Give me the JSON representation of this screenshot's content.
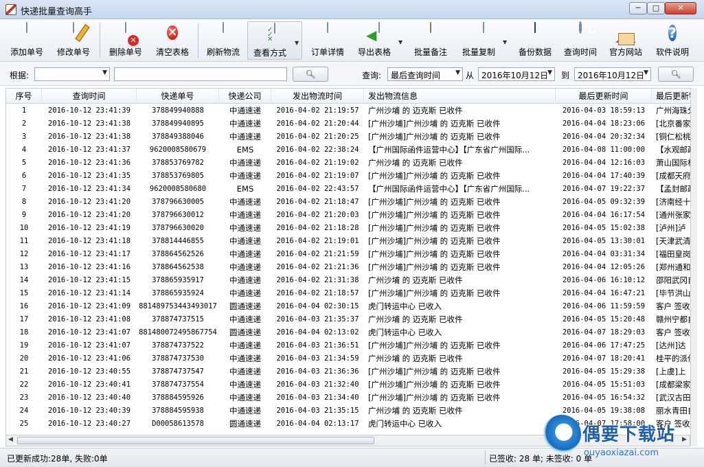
{
  "window": {
    "title": "快递批量查询高手",
    "controls": {
      "minimize": "─",
      "maximize": "□",
      "close": "✕"
    }
  },
  "toolbar": {
    "add": "添加单号",
    "edit": "修改单号",
    "delete": "删除单号",
    "clear": "清空表格",
    "refresh": "刷新物流",
    "view": "查看方式",
    "detail": "订单详情",
    "export": "导出表格",
    "batch_note": "批量备注",
    "batch_copy": "批量复制",
    "backup": "备份数据",
    "query_time": "查询时间",
    "website": "官方网站",
    "help": "软件说明"
  },
  "search": {
    "by_label": "根据:",
    "by_value": "",
    "keyword": "",
    "query_label": "查询:",
    "query_mode": "最后查询时间",
    "from_label": "从",
    "from_date": "2016年10月12日",
    "to_label": "到",
    "to_date": "2016年10月12日"
  },
  "table": {
    "columns": [
      "序号",
      "查询时间",
      "快递单号",
      "快递公司",
      "发出物流时间",
      "发出物流信息",
      "最后更新时间",
      "最后更新物"
    ],
    "rows": [
      [
        "1",
        "2016-10-12 23:41:39",
        "378849940888",
        "中通速递",
        "2016-04-02 21:19:57",
        "广州沙埔 的 迈克斯 已收件",
        "2016-04-03 18:59:13",
        "广州海珠分"
      ],
      [
        "2",
        "2016-10-12 23:41:38",
        "378849940895",
        "中通速递",
        "2016-04-02 21:20:44",
        "[广州沙埔]广州沙埔 的 迈克斯 已收件",
        "2016-04-04 18:23:06",
        "[北京番家"
      ],
      [
        "3",
        "2016-10-12 23:41:38",
        "378849388046",
        "中通速递",
        "2016-04-02 21:20:25",
        "[广州沙埔]广州沙埔 的 迈克斯 已收件",
        "2016-04-04 20:32:34",
        "[铜仁松桃"
      ],
      [
        "4",
        "2016-10-12 23:41:37",
        "9620008580679",
        "EMS",
        "2016-04-02 22:38:24",
        "【广州国际函件运营中心】【广东省广州国际...",
        "2016-04-08 11:00:00",
        "【水观邮政"
      ],
      [
        "5",
        "2016-10-12 23:41:36",
        "378853769782",
        "中通速递",
        "2016-04-02 21:19:02",
        "广州沙埔 的 迈克斯 已收件",
        "2016-04-04 12:16:03",
        "萧山国际机"
      ],
      [
        "6",
        "2016-10-12 23:41:35",
        "378853769805",
        "中通速递",
        "2016-04-02 21:19:07",
        "[广州沙埔]广州沙埔 的 迈克斯 已收件",
        "2016-04-04 17:40:39",
        "[成都天府"
      ],
      [
        "7",
        "2016-10-12 23:41:34",
        "9620008580680",
        "EMS",
        "2016-04-02 22:43:57",
        "【广州国际函件运营中心】【广东省广州国际...",
        "2016-04-07 19:22:37",
        "【孟封邮政"
      ],
      [
        "8",
        "2016-10-12 23:41:20",
        "378796630005",
        "中通速递",
        "2016-04-02 21:18:47",
        "[广州沙埔]广州沙埔 的 迈克斯 已收件",
        "2016-04-05 09:32:39",
        "[济南经十"
      ],
      [
        "9",
        "2016-10-12 23:41:20",
        "378796630012",
        "中通速递",
        "2016-04-02 21:20:03",
        "[广州沙埔]广州沙埔 的 迈克斯 已收件",
        "2016-04-04 16:17:54",
        "[通州张家"
      ],
      [
        "10",
        "2016-10-12 23:41:19",
        "378796630020",
        "中通速递",
        "2016-04-02 21:18:28",
        "[广州沙埔]广州沙埔 的 迈克斯 已收件",
        "2016-04-05 15:02:38",
        "[泸州]泸"
      ],
      [
        "11",
        "2016-10-12 23:41:18",
        "378814446855",
        "中通速递",
        "2016-04-02 21:19:01",
        "[广州沙埔]广州沙埔 的 迈克斯 已收件",
        "2016-04-05 13:30:01",
        "[天津武清"
      ],
      [
        "12",
        "2016-10-12 23:41:17",
        "378864562526",
        "中通速递",
        "2016-04-02 21:21:59",
        "[广州沙埔]广州沙埔 的 迈克斯 已收件",
        "2016-04-04 03:31:34",
        "[福田皇岗"
      ],
      [
        "13",
        "2016-10-12 23:41:16",
        "378864562538",
        "中通速递",
        "2016-04-02 21:21:36",
        "[广州沙埔]广州沙埔 的 迈克斯 已收件",
        "2016-04-04 12:05:26",
        "[郑州通和"
      ],
      [
        "14",
        "2016-10-12 23:41:15",
        "378865935917",
        "中通速递",
        "2016-04-02 21:31:38",
        "广州沙埔 的 迈克斯 已收件",
        "2016-04-06 16:10:12",
        "邵阳武冈自"
      ],
      [
        "15",
        "2016-10-12 23:41:14",
        "378865935924",
        "中通速递",
        "2016-04-02 21:18:57",
        "[广州沙埔]广州沙埔 的 迈克斯 已收件",
        "2016-04-04 16:47:21",
        "[毕节洪山"
      ],
      [
        "16",
        "2016-10-12 23:41:09",
        "881489753443493017",
        "圆通速递",
        "2016-04-04 02:30:15",
        "虎门转运中心 已收入",
        "2016-04-06 11:59:59",
        "客户 签收"
      ],
      [
        "17",
        "2016-10-12 23:41:08",
        "378874737515",
        "中通速递",
        "2016-04-03 21:35:37",
        "广州沙埔 的 迈克斯 已收件",
        "2016-04-05 15:20:48",
        "赣州宁都自"
      ],
      [
        "18",
        "2016-10-12 23:41:07",
        "881480072495867754",
        "圆通速递",
        "2016-04-04 02:13:02",
        "虎门转运中心 已收入",
        "2016-04-07 18:29:03",
        "客户 签收"
      ],
      [
        "19",
        "2016-10-12 23:41:07",
        "378874737522",
        "中通速递",
        "2016-04-03 21:36:51",
        "[广州沙埔]广州沙埔 的 迈克斯 已收件",
        "2016-04-06 17:47:25",
        "[达州]达"
      ],
      [
        "20",
        "2016-10-12 23:41:06",
        "378874737530",
        "中通速递",
        "2016-04-03 21:34:59",
        "广州沙埔 的 迈克斯 已收件",
        "2016-04-07 18:20:41",
        "桂平的派件"
      ],
      [
        "21",
        "2016-10-12 23:40:55",
        "378874737547",
        "中通速递",
        "2016-04-03 21:36:36",
        "[广州沙埔]广州沙埔 的 迈克斯 已收件",
        "2016-04-05 15:29:38",
        "[上虞]上"
      ],
      [
        "22",
        "2016-10-12 23:40:41",
        "378874737554",
        "中通速递",
        "2016-04-03 21:32:40",
        "[广州沙埔]广州沙埔 的 迈克斯 已收件",
        "2016-04-05 15:51:03",
        "[成都梁家"
      ],
      [
        "23",
        "2016-10-12 23:40:40",
        "378884595926",
        "中通速递",
        "2016-04-03 21:34:40",
        "[广州沙埔]广州沙埔 的 迈克斯 已收件",
        "2016-04-05 16:54:32",
        "[武汉古田"
      ],
      [
        "24",
        "2016-10-12 23:40:39",
        "378884595938",
        "中通速递",
        "2016-04-03 21:35:15",
        "广州沙埔 的 迈克斯 已收件",
        "2016-04-05 19:38:08",
        "丽水青田自"
      ],
      [
        "25",
        "2016-10-12 23:40:27",
        "D00058613578",
        "圆通速递",
        "2016-04-04 02:13:17",
        "虎门转运中心 已收入",
        "2016-04-07 17:58:00",
        "客户 签收"
      ]
    ]
  },
  "status": {
    "update_result": "已更新成功:28单, 失败:0单",
    "signed": "已签收: 28 单; 未签收: 0 单"
  },
  "watermark": {
    "brand": "偶要下载站",
    "domain": "ouyaoxiazai.com"
  }
}
